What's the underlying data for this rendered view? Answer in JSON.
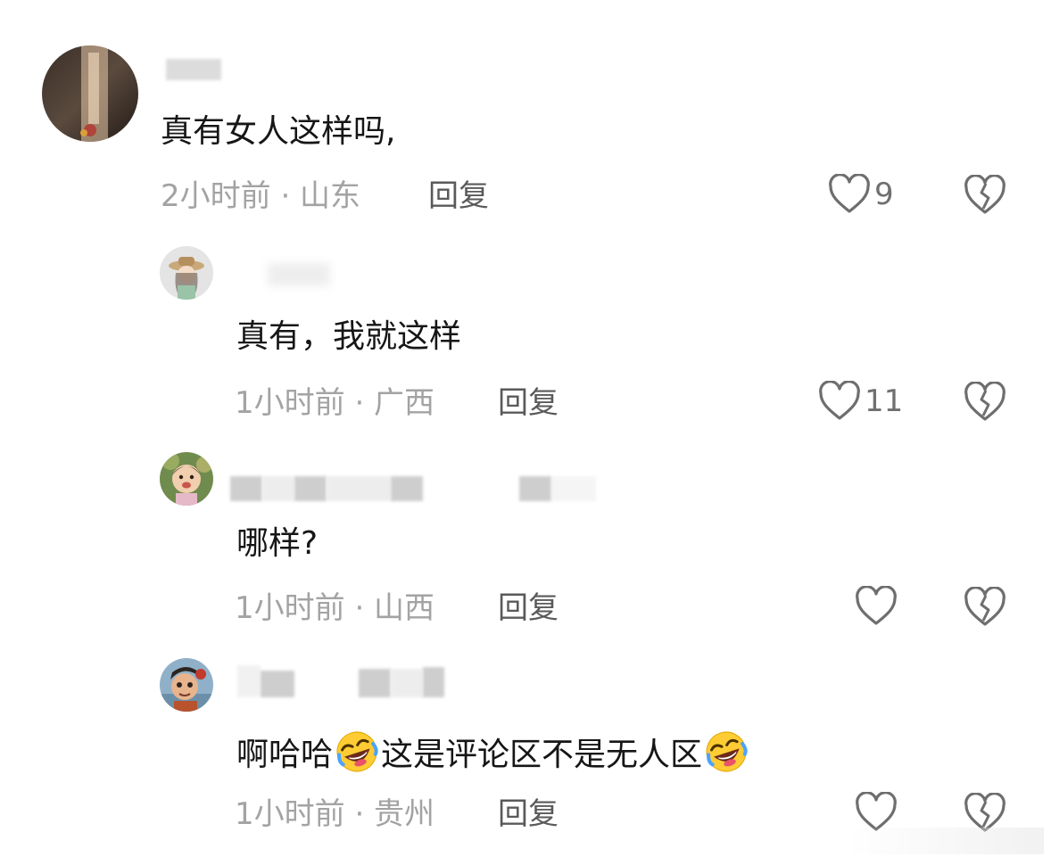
{
  "comments": [
    {
      "text": "真有女人这样吗,",
      "meta": "2小时前 · 山东",
      "reply_label": "回复",
      "like_count": "9"
    },
    {
      "text": "真有，我就这样",
      "meta": "1小时前 · 广西",
      "reply_label": "回复",
      "like_count": "11"
    },
    {
      "text": "哪样?",
      "meta": "1小时前 · 山西",
      "reply_label": "回复",
      "like_count": ""
    },
    {
      "text_part1": "啊哈哈",
      "text_part2": "这是评论区不是无人区",
      "meta": "1小时前 · 贵州",
      "reply_label": "回复",
      "like_count": ""
    }
  ],
  "icons": {
    "like": "heart-outline-icon",
    "dislike": "broken-heart-icon",
    "emoji": "rofl-emoji-icon"
  },
  "colors": {
    "text": "#161616",
    "meta": "#a3a3a3",
    "reply": "#5a5a5a",
    "icon": "#6e6e6e"
  }
}
